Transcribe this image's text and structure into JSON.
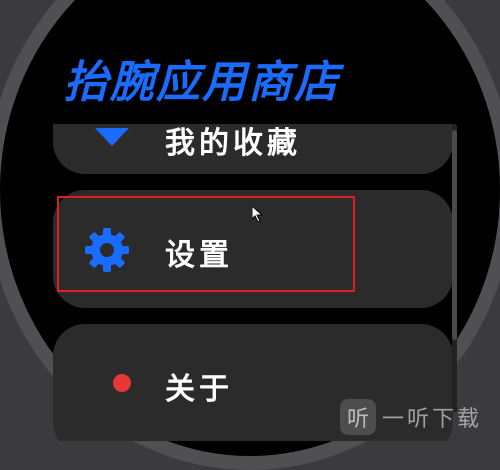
{
  "app": {
    "title": "抬腕应用商店",
    "accent_color": "#1a6cff",
    "highlight_color": "#e11d24"
  },
  "menu": {
    "items": [
      {
        "label": "我的收藏",
        "icon": "diamond-icon",
        "icon_color": "#1a6cff"
      },
      {
        "label": "设置",
        "icon": "gear-icon",
        "icon_color": "#1a6cff"
      },
      {
        "label": "关于",
        "icon": "red-dot-icon",
        "icon_color": "#e53935"
      }
    ]
  },
  "watermark": {
    "logo": "听",
    "text": "一听下载"
  }
}
